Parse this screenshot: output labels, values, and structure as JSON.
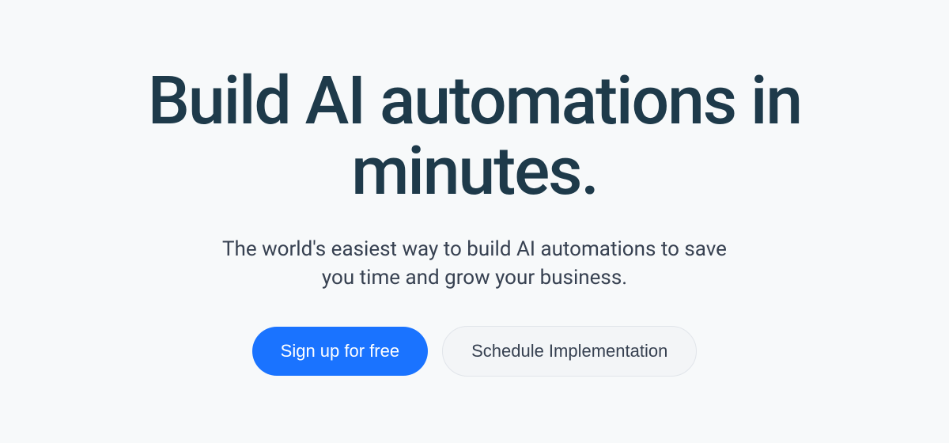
{
  "hero": {
    "title": "Build AI automations in minutes.",
    "subtitle": "The world's easiest way to build AI automations to save you time and grow your business.",
    "cta_primary": "Sign up for free",
    "cta_secondary": "Schedule Implementation"
  }
}
